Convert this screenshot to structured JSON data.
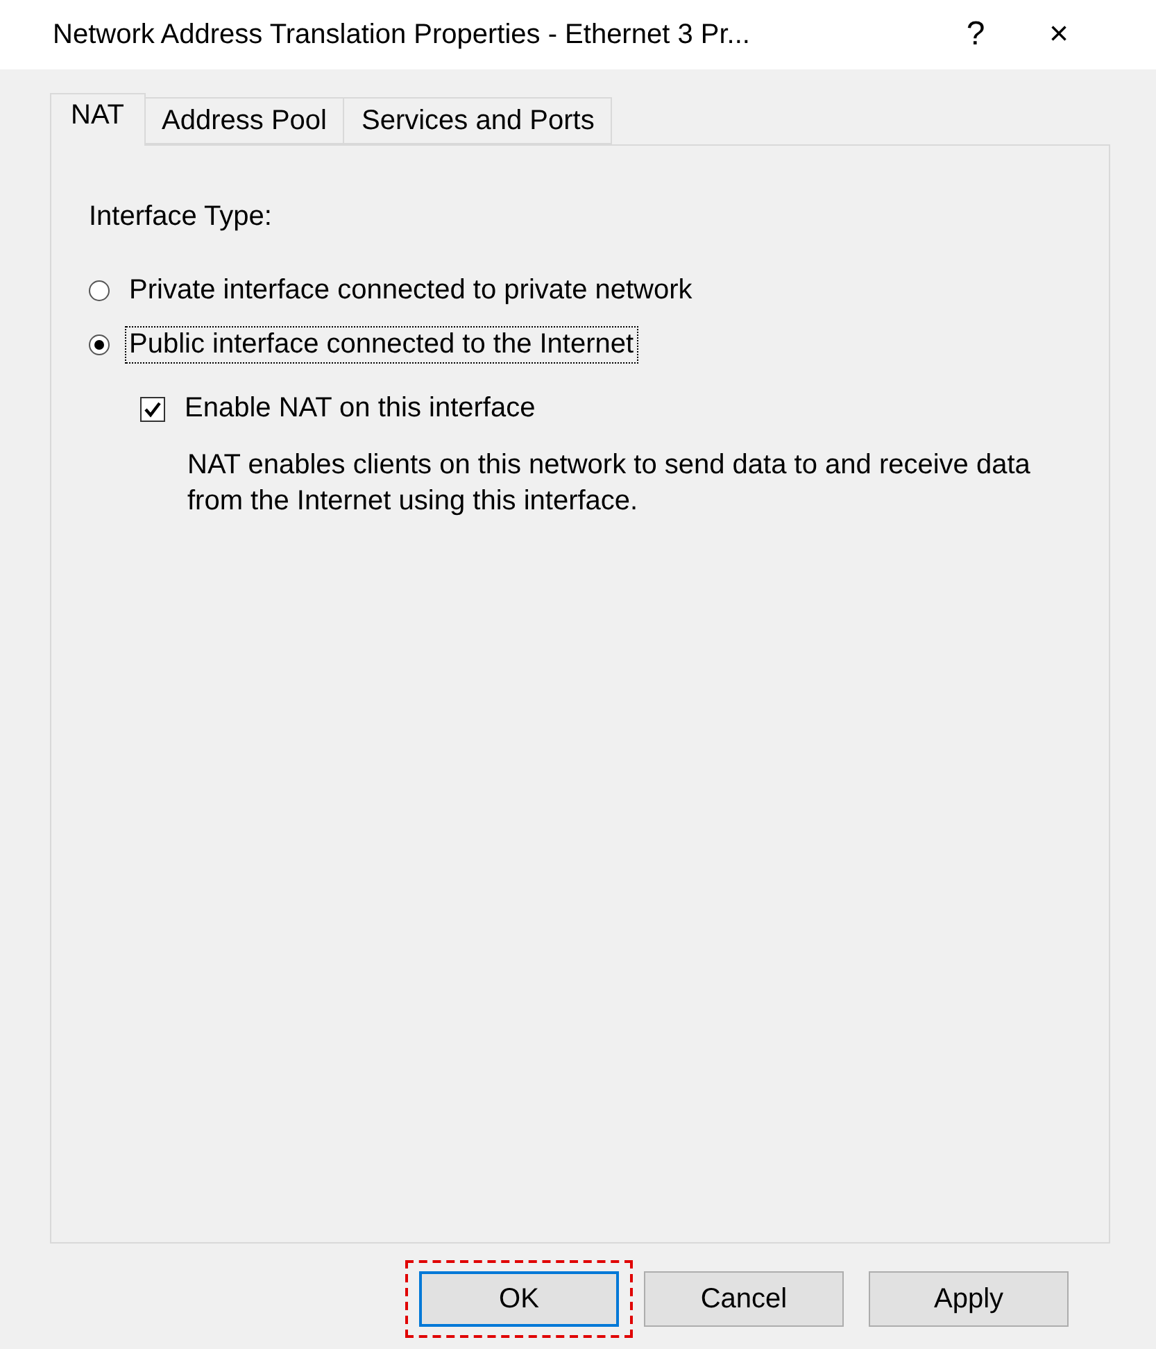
{
  "window": {
    "title": "Network Address Translation Properties - Ethernet 3 Pr...",
    "help": "?",
    "close": "×"
  },
  "tabs": [
    {
      "label": "NAT",
      "selected": true
    },
    {
      "label": "Address Pool",
      "selected": false
    },
    {
      "label": "Services and Ports",
      "selected": false
    }
  ],
  "group_label": "Interface Type:",
  "radios": [
    {
      "label": "Private interface connected to private network",
      "selected": false,
      "focused": false
    },
    {
      "label": "Public interface connected to the Internet",
      "selected": true,
      "focused": true
    }
  ],
  "checkbox": {
    "label": "Enable NAT on this interface",
    "checked": true
  },
  "description": "NAT enables clients on this network to send data to and receive data from the Internet using this interface.",
  "buttons": [
    {
      "label": "OK",
      "default": true,
      "highlighted": true
    },
    {
      "label": "Cancel",
      "default": false,
      "highlighted": false
    },
    {
      "label": "Apply",
      "default": false,
      "highlighted": false
    }
  ]
}
